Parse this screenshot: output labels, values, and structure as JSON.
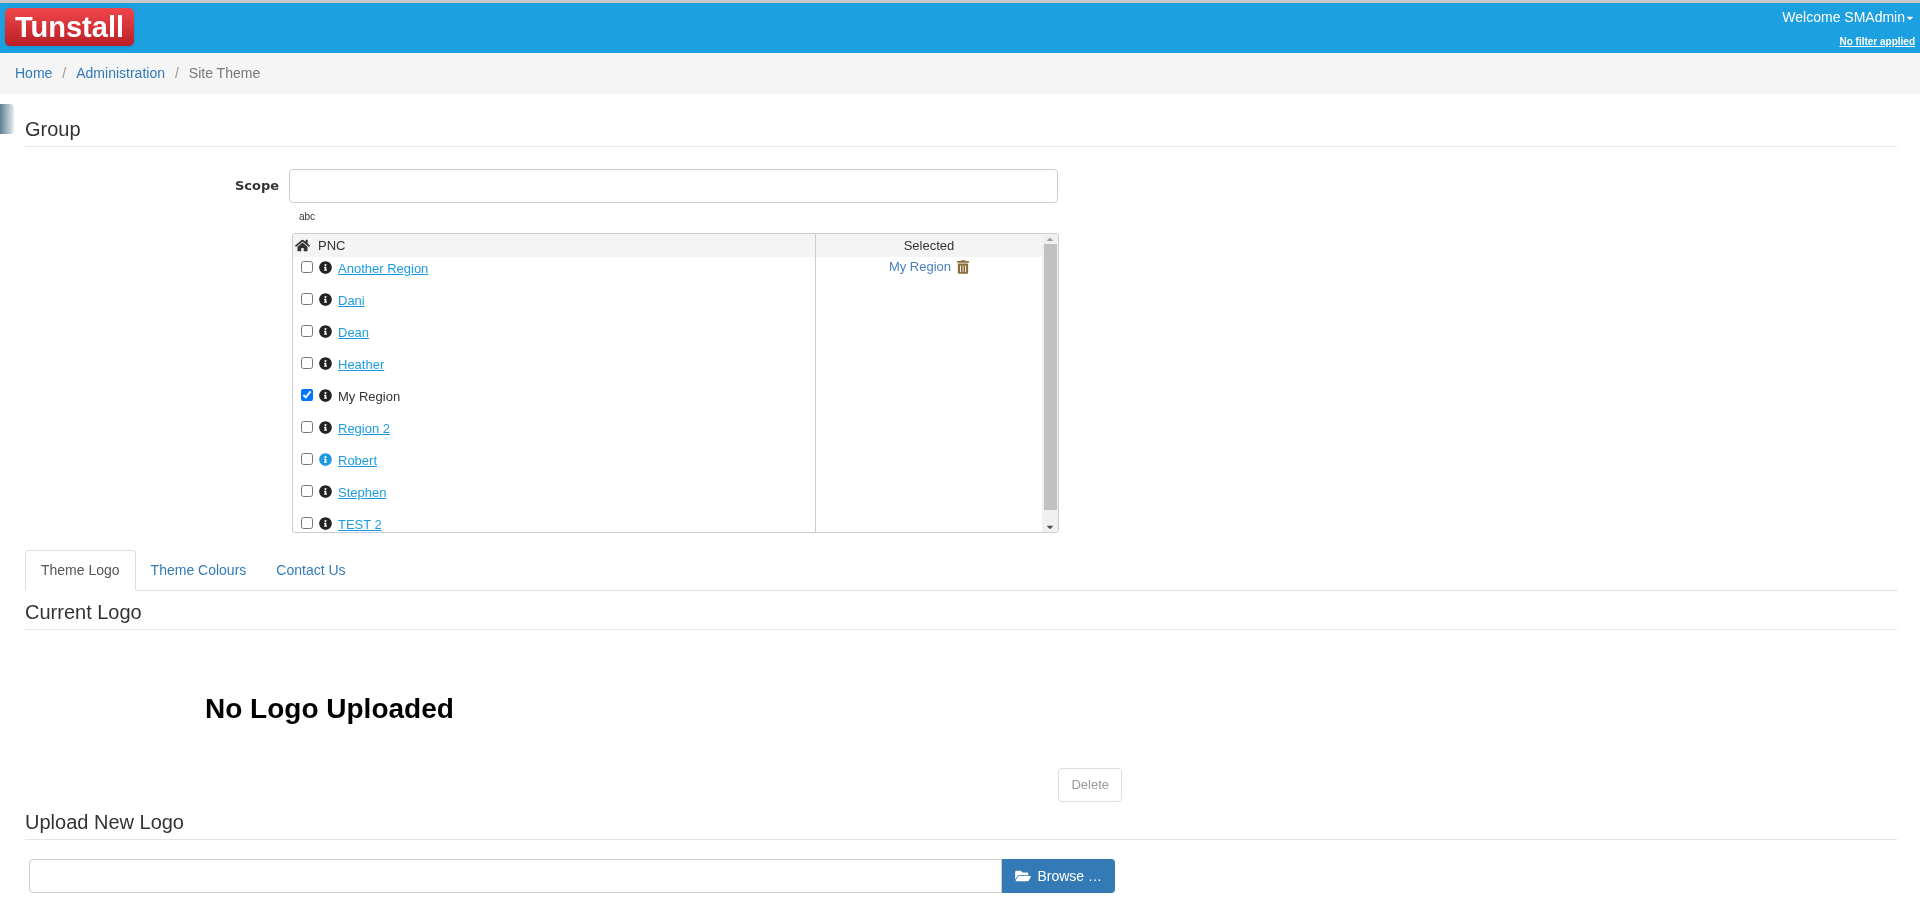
{
  "header": {
    "logo": "Tunstall",
    "welcome": "Welcome SMAdmin",
    "filter_link": "No filter applied"
  },
  "breadcrumb_separator": "/",
  "breadcrumb": [
    {
      "label": "Home",
      "link": true
    },
    {
      "label": "Administration",
      "link": true
    },
    {
      "label": "Site Theme",
      "link": false
    }
  ],
  "group": {
    "heading": "Group",
    "scope_label": "Scope",
    "scope_hint": "abc",
    "tree": {
      "root": "PNC",
      "selected_heading": "Selected",
      "items": [
        {
          "label": "Another Region",
          "checked": false,
          "info_highlighted": false
        },
        {
          "label": "Dani",
          "checked": false,
          "info_highlighted": false
        },
        {
          "label": "Dean",
          "checked": false,
          "info_highlighted": false
        },
        {
          "label": "Heather",
          "checked": false,
          "info_highlighted": false
        },
        {
          "label": "My Region",
          "checked": true,
          "info_highlighted": false
        },
        {
          "label": "Region 2",
          "checked": false,
          "info_highlighted": false
        },
        {
          "label": "Robert",
          "checked": false,
          "info_highlighted": true
        },
        {
          "label": "Stephen",
          "checked": false,
          "info_highlighted": false
        },
        {
          "label": "TEST 2",
          "checked": false,
          "info_highlighted": false
        }
      ],
      "selected_items": [
        "My Region"
      ]
    }
  },
  "tabs": [
    {
      "label": "Theme Logo",
      "selected": true
    },
    {
      "label": "Theme Colours",
      "selected": false
    },
    {
      "label": "Contact Us",
      "selected": false
    }
  ],
  "current_logo": {
    "heading": "Current Logo",
    "message": "No Logo Uploaded",
    "delete_button": "Delete"
  },
  "upload": {
    "heading": "Upload New Logo",
    "browse_button": "Browse …"
  }
}
